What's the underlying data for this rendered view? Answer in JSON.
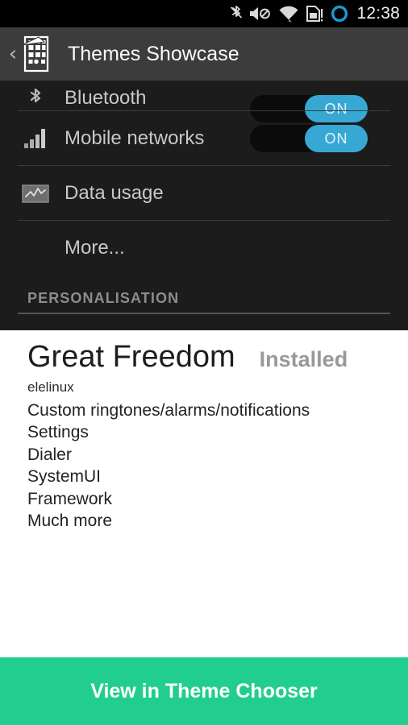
{
  "status_bar": {
    "time": "12:38",
    "icons": [
      {
        "name": "bluetooth-icon",
        "label": "Bluetooth"
      },
      {
        "name": "volume-mute-icon",
        "label": "Silent"
      },
      {
        "name": "wifi-icon",
        "label": "Wi-Fi"
      },
      {
        "name": "sim-card-alert-icon",
        "label": "No SIM"
      },
      {
        "name": "sync-circle-icon",
        "label": "Syncing",
        "color": "#1a9bd0"
      }
    ]
  },
  "action_bar": {
    "back_label": "‹",
    "app_icon_name": "theme-chooser-icon",
    "title": "Themes Showcase"
  },
  "preview": {
    "rows": [
      {
        "icon": "bluetooth-icon",
        "label": "Bluetooth",
        "toggle": "ON",
        "clipped": true
      },
      {
        "icon": "signal-bars-icon",
        "label": "Mobile networks",
        "toggle": "ON",
        "clipped": false
      },
      {
        "icon": "data-usage-icon",
        "label": "Data usage",
        "toggle": null,
        "clipped": false
      },
      {
        "icon": null,
        "label": "More...",
        "toggle": null,
        "clipped": false
      }
    ],
    "section_label": "PERSONALISATION"
  },
  "detail": {
    "title": "Great Freedom",
    "status": "Installed",
    "author": "elelinux",
    "features": [
      "Custom ringtones/alarms/notifications",
      "Settings",
      "Dialer",
      "SystemUI",
      "Framework",
      "Much more"
    ]
  },
  "cta": {
    "label": "View in Theme Chooser",
    "color": "#21ce8f"
  },
  "colors": {
    "status_bar_bg": "#000000",
    "action_bar_bg": "#3c3c3c",
    "preview_bg": "#1c1c1c",
    "toggle_on": "#37a8d4",
    "accent_green": "#21ce8f",
    "body_bg": "#ffffff"
  }
}
